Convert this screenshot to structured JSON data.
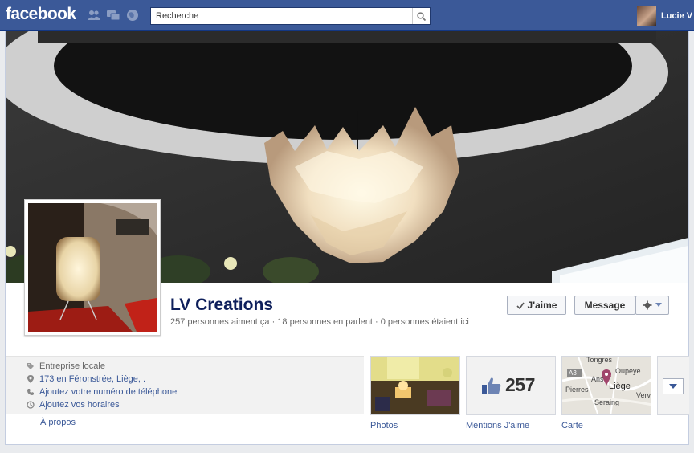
{
  "topbar": {
    "logo": "facebook",
    "search_placeholder": "Recherche",
    "user_name": "Lucie V",
    "icons": [
      "friend-requests-icon",
      "messages-icon",
      "notifications-icon",
      "search-icon"
    ]
  },
  "page": {
    "name": "LV Creations",
    "stats": "257 personnes aiment ça · 18 personnes en parlent · 0 personnes étaient ici",
    "actions": {
      "like_label": "J'aime",
      "message_label": "Message"
    },
    "about": {
      "category": "Entreprise locale",
      "address": "173 en Féronstrée, Liège, .",
      "add_phone": "Ajoutez votre numéro de téléphone",
      "add_hours": "Ajoutez vos horaires",
      "link": "À propos"
    },
    "apps": {
      "photos_label": "Photos",
      "likes_label": "Mentions J'aime",
      "likes_count": "257",
      "map_label": "Carte",
      "map_places": [
        "Tongres",
        "Oupeye",
        "Ans",
        "Liège",
        "Pierres",
        "Seraing",
        "Vervi",
        "A3"
      ]
    }
  },
  "colors": {
    "brand_blue": "#3b5998",
    "page_name": "#0e1f5b",
    "map_pin": "#a0456b"
  }
}
